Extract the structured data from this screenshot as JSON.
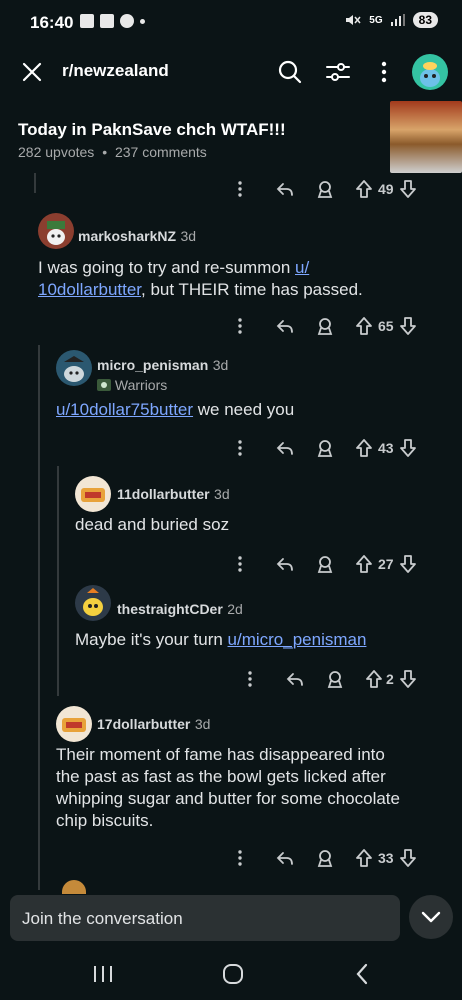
{
  "status": {
    "time": "16:40",
    "network": "5G",
    "battery": "83"
  },
  "header": {
    "subreddit": "r/newzealand"
  },
  "post": {
    "title": "Today in PaknSave chch WTAF!!!",
    "upvotes": "282 upvotes",
    "separator": "•",
    "comments": "237 comments"
  },
  "rows": {
    "r0": {
      "votes": "49"
    },
    "c1": {
      "user": "markosharkNZ",
      "time": "3d",
      "body_pre": "I was going to try and re-summon ",
      "link": "u/10dollarbutter",
      "link_line1": "u/",
      "link_line2": "10dollarbutter",
      "body_post": ", but THEIR time has passed.",
      "votes": "65"
    },
    "c2": {
      "user": "micro_penisman",
      "time": "3d",
      "flair": "Warriors",
      "link": "u/10dollar75butter",
      "body_post": " we need you",
      "votes": "43"
    },
    "c3": {
      "user": "11dollarbutter",
      "time": "3d",
      "body": "dead and buried soz",
      "votes": "27"
    },
    "c4": {
      "user": "thestraightCDer",
      "time": "2d",
      "body_pre": "Maybe it's your turn ",
      "link": "u/micro_penisman",
      "votes": "2"
    },
    "c5": {
      "user": "17dollarbutter",
      "time": "3d",
      "body_lines": [
        "Their moment of fame has disappeared into",
        "the past as fast as the bowl gets licked after",
        "whipping sugar and butter for some chocolate",
        "chip biscuits."
      ],
      "votes": "33"
    }
  },
  "composer": {
    "placeholder": "Join the conversation"
  },
  "colors": {
    "background": "#0b1416",
    "link": "#7ea7ff",
    "text": "#d7dadc",
    "muted": "#a8aaab"
  }
}
